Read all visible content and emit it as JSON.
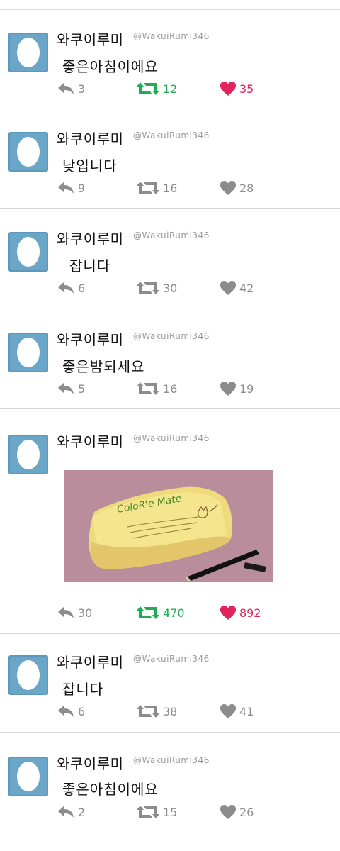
{
  "user": {
    "name": "와쿠이루미",
    "handle": "@WakuiRumi346"
  },
  "tweets": [
    {
      "text": "좋은아침이에요",
      "replies": "3",
      "retweets": "12",
      "likes": "35",
      "retweeted": true,
      "liked": true,
      "show_handle": true
    },
    {
      "text": "낮입니다",
      "replies": "9",
      "retweets": "16",
      "likes": "28",
      "retweeted": false,
      "liked": false,
      "show_handle": true
    },
    {
      "text": "잡니다",
      "replies": "6",
      "retweets": "30",
      "likes": "42",
      "retweeted": false,
      "liked": false,
      "show_handle": true
    },
    {
      "text": "좋은밤되세요",
      "replies": "5",
      "retweets": "16",
      "likes": "19",
      "retweeted": false,
      "liked": false,
      "show_handle": true
    },
    {
      "text": "",
      "replies": "30",
      "retweets": "470",
      "likes": "892",
      "retweeted": true,
      "liked": true,
      "show_handle": true,
      "media": {
        "caption": "ColoR'e Mate"
      }
    },
    {
      "text": "잡니다",
      "replies": "6",
      "retweets": "38",
      "likes": "41",
      "retweeted": false,
      "liked": false,
      "show_handle": true
    },
    {
      "text": "좋은아침이에요",
      "replies": "2",
      "retweets": "15",
      "likes": "26",
      "retweeted": false,
      "liked": false,
      "show_handle": true
    }
  ],
  "colors": {
    "avatar": "#6aa6c8",
    "retweet_active": "#1fae55",
    "like_active": "#e0245e",
    "inactive": "#8c8c8c"
  }
}
